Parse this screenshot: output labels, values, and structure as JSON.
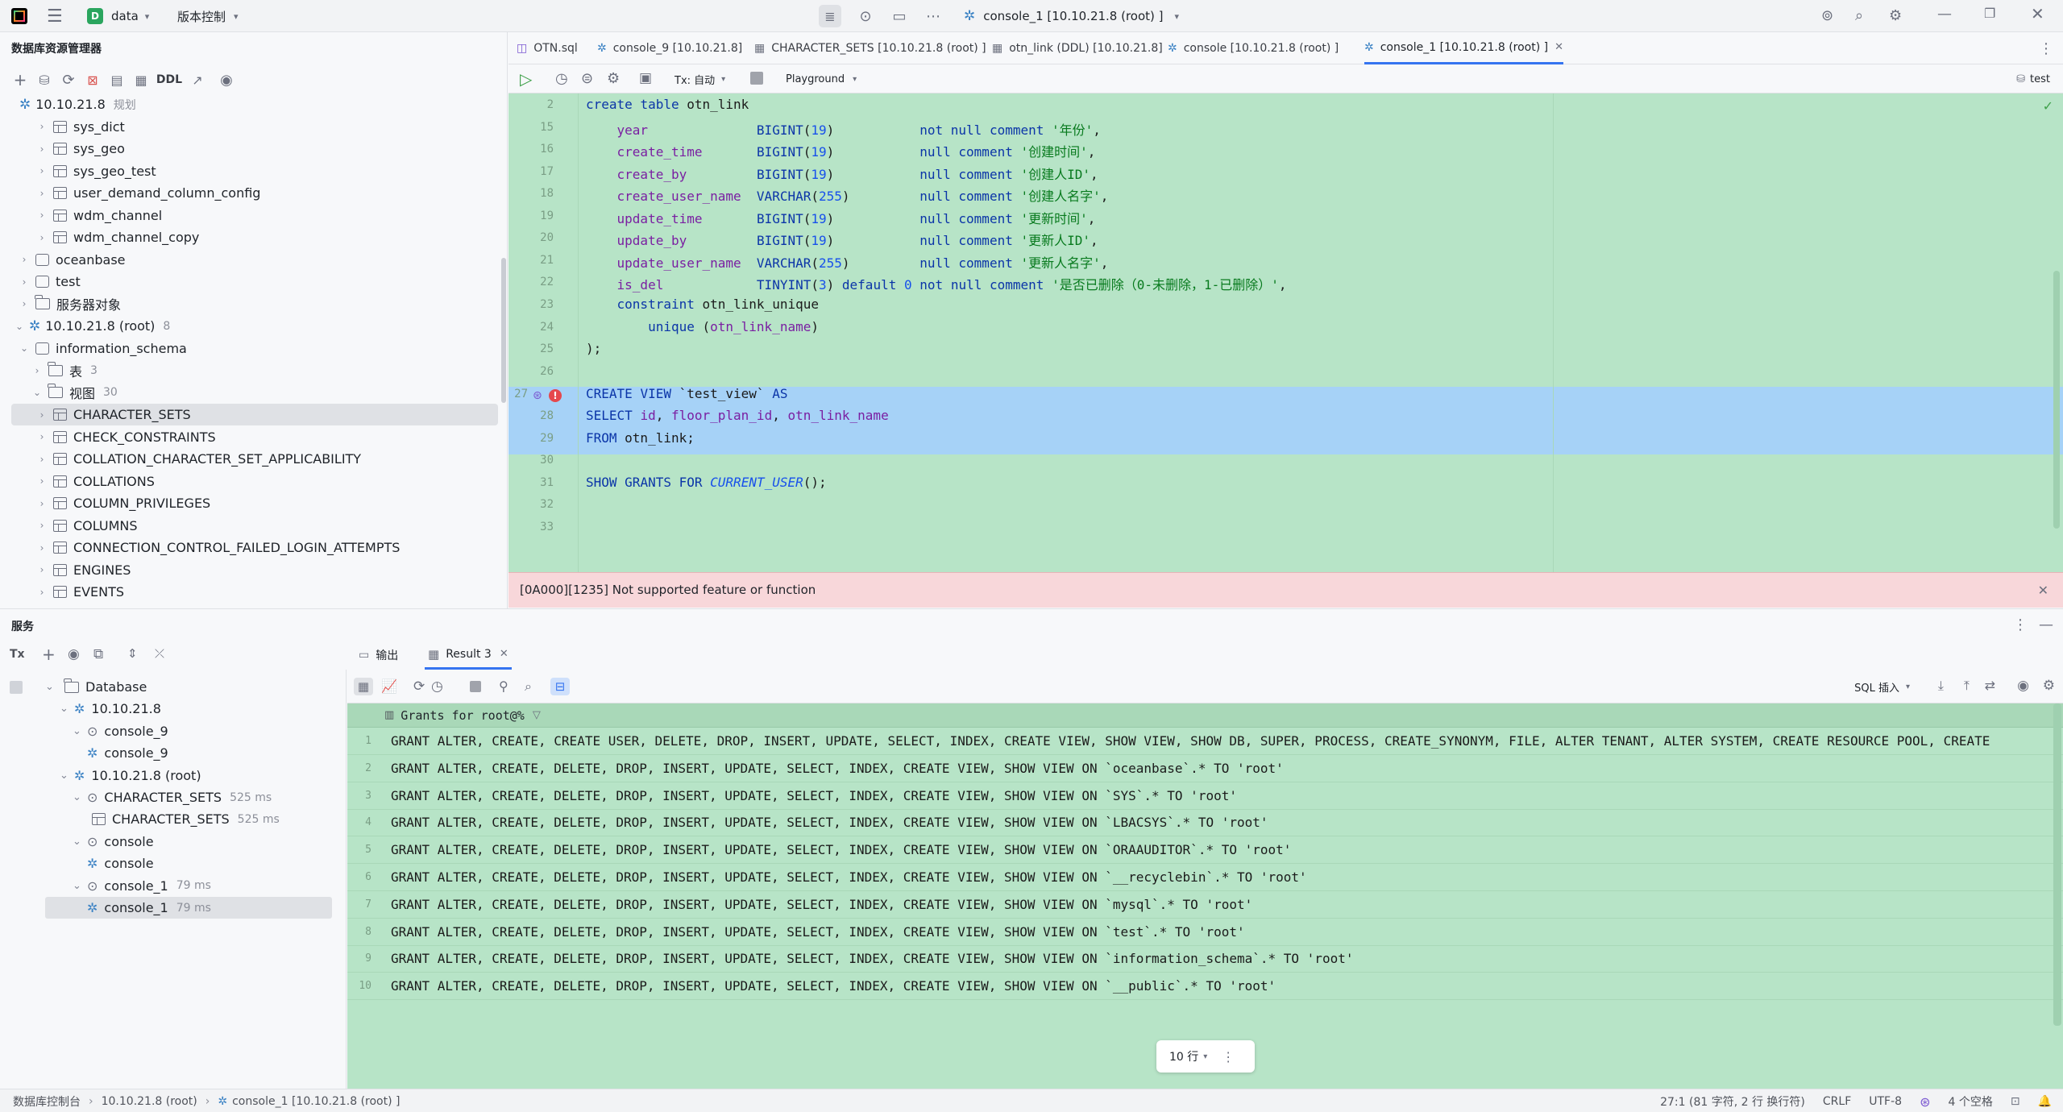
{
  "titlebar": {
    "project_badge": "D",
    "project": "data",
    "vcs": "版本控制",
    "run_config": "console_1 [10.10.21.8 (root) ]"
  },
  "explorer": {
    "title": "数据库资源管理器",
    "ddl_label": "DDL",
    "rows": [
      {
        "label": "10.10.21.8",
        "note": "规划",
        "kind": "conn"
      },
      {
        "label": "sys_dict",
        "kind": "table"
      },
      {
        "label": "sys_geo",
        "kind": "table"
      },
      {
        "label": "sys_geo_test",
        "kind": "table"
      },
      {
        "label": "user_demand_column_config",
        "kind": "table"
      },
      {
        "label": "wdm_channel",
        "kind": "table"
      },
      {
        "label": "wdm_channel_copy",
        "kind": "table"
      },
      {
        "label": "oceanbase",
        "kind": "db"
      },
      {
        "label": "test",
        "kind": "db"
      },
      {
        "label": "服务器对象",
        "kind": "folder"
      },
      {
        "label": "10.10.21.8  (root)",
        "note": "8",
        "kind": "conn"
      },
      {
        "label": "information_schema",
        "kind": "db"
      },
      {
        "label": "表",
        "note": "3",
        "kind": "folder"
      },
      {
        "label": "视图",
        "note": "30",
        "kind": "folder"
      },
      {
        "label": "CHARACTER_SETS",
        "kind": "table"
      },
      {
        "label": "CHECK_CONSTRAINTS",
        "kind": "table"
      },
      {
        "label": "COLLATION_CHARACTER_SET_APPLICABILITY",
        "kind": "table"
      },
      {
        "label": "COLLATIONS",
        "kind": "table"
      },
      {
        "label": "COLUMN_PRIVILEGES",
        "kind": "table"
      },
      {
        "label": "COLUMNS",
        "kind": "table"
      },
      {
        "label": "CONNECTION_CONTROL_FAILED_LOGIN_ATTEMPTS",
        "kind": "table"
      },
      {
        "label": "ENGINES",
        "kind": "table"
      },
      {
        "label": "EVENTS",
        "kind": "table"
      }
    ]
  },
  "tabs": [
    {
      "label": "OTN.sql"
    },
    {
      "label": "console_9 [10.10.21.8]"
    },
    {
      "label": "CHARACTER_SETS [10.10.21.8  (root) ]"
    },
    {
      "label": "otn_link (DDL) [10.10.21.8]"
    },
    {
      "label": "console [10.10.21.8  (root) ]"
    },
    {
      "label": "console_1 [10.10.21.8  (root) ]"
    }
  ],
  "toolbar": {
    "tx_label": "Tx: 自动",
    "playground": "Playground",
    "schema": "test"
  },
  "editor": {
    "lines": [
      {
        "n": "2",
        "code": "create table otn_link"
      },
      {
        "n": "15",
        "code": "    year              BIGINT(19)           not null comment '年份',"
      },
      {
        "n": "16",
        "code": "    create_time       BIGINT(19)           null comment '创建时间',"
      },
      {
        "n": "17",
        "code": "    create_by         BIGINT(19)           null comment '创建人ID',"
      },
      {
        "n": "18",
        "code": "    create_user_name  VARCHAR(255)         null comment '创建人名字',"
      },
      {
        "n": "19",
        "code": "    update_time       BIGINT(19)           null comment '更新时间',"
      },
      {
        "n": "20",
        "code": "    update_by         BIGINT(19)           null comment '更新人ID',"
      },
      {
        "n": "21",
        "code": "    update_user_name  VARCHAR(255)         null comment '更新人名字',"
      },
      {
        "n": "22",
        "code": "    is_del            TINYINT(3) default 0 not null comment '是否已删除（0-未删除，1-已删除）',"
      },
      {
        "n": "23",
        "code": "    constraint otn_link_unique"
      },
      {
        "n": "24",
        "code": "        unique (otn_link_name)"
      },
      {
        "n": "25",
        "code": ");"
      },
      {
        "n": "26",
        "code": ""
      },
      {
        "n": "27",
        "code": "CREATE VIEW `test_view` AS"
      },
      {
        "n": "28",
        "code": "SELECT id, floor_plan_id, otn_link_name"
      },
      {
        "n": "29",
        "code": "FROM otn_link;"
      },
      {
        "n": "30",
        "code": ""
      },
      {
        "n": "31",
        "code": "SHOW GRANTS FOR CURRENT_USER();"
      },
      {
        "n": "32",
        "code": ""
      },
      {
        "n": "33",
        "code": ""
      }
    ],
    "error": "[0A000][1235] Not supported feature or function"
  },
  "services": {
    "title": "服务",
    "tx": "Tx",
    "tree": [
      {
        "label": "Database",
        "time": "",
        "level": 0
      },
      {
        "label": "10.10.21.8",
        "time": "",
        "level": 1
      },
      {
        "label": "console_9",
        "time": "",
        "level": 2
      },
      {
        "label": "console_9",
        "time": "",
        "level": 3
      },
      {
        "label": "10.10.21.8  (root)",
        "time": "",
        "level": 1
      },
      {
        "label": "CHARACTER_SETS",
        "time": "525 ms",
        "level": 2
      },
      {
        "label": "CHARACTER_SETS",
        "time": "525 ms",
        "level": 3
      },
      {
        "label": "console",
        "time": "",
        "level": 2
      },
      {
        "label": "console",
        "time": "",
        "level": 3
      },
      {
        "label": "console_1",
        "time": "79 ms",
        "level": 2
      },
      {
        "label": "console_1",
        "time": "79 ms",
        "level": 3
      }
    ]
  },
  "results": {
    "tab_output": "输出",
    "tab_result": "Result 3",
    "sql_insert": "SQL 插入",
    "column": "Grants for root@%",
    "rows": [
      "GRANT ALTER, CREATE, CREATE USER, DELETE, DROP, INSERT, UPDATE, SELECT, INDEX, CREATE VIEW, SHOW VIEW, SHOW DB, SUPER, PROCESS, CREATE_SYNONYM, FILE, ALTER TENANT, ALTER SYSTEM, CREATE RESOURCE POOL, CREATE",
      "GRANT ALTER, CREATE, DELETE, DROP, INSERT, UPDATE, SELECT, INDEX, CREATE VIEW, SHOW VIEW ON `oceanbase`.* TO 'root'",
      "GRANT ALTER, CREATE, DELETE, DROP, INSERT, UPDATE, SELECT, INDEX, CREATE VIEW, SHOW VIEW ON `SYS`.* TO 'root'",
      "GRANT ALTER, CREATE, DELETE, DROP, INSERT, UPDATE, SELECT, INDEX, CREATE VIEW, SHOW VIEW ON `LBACSYS`.* TO 'root'",
      "GRANT ALTER, CREATE, DELETE, DROP, INSERT, UPDATE, SELECT, INDEX, CREATE VIEW, SHOW VIEW ON `ORAAUDITOR`.* TO 'root'",
      "GRANT ALTER, CREATE, DELETE, DROP, INSERT, UPDATE, SELECT, INDEX, CREATE VIEW, SHOW VIEW ON `__recyclebin`.* TO 'root'",
      "GRANT ALTER, CREATE, DELETE, DROP, INSERT, UPDATE, SELECT, INDEX, CREATE VIEW, SHOW VIEW ON `mysql`.* TO 'root'",
      "GRANT ALTER, CREATE, DELETE, DROP, INSERT, UPDATE, SELECT, INDEX, CREATE VIEW, SHOW VIEW ON `test`.* TO 'root'",
      "GRANT ALTER, CREATE, DELETE, DROP, INSERT, UPDATE, SELECT, INDEX, CREATE VIEW, SHOW VIEW ON `information_schema`.* TO 'root'",
      "GRANT ALTER, CREATE, DELETE, DROP, INSERT, UPDATE, SELECT, INDEX, CREATE VIEW, SHOW VIEW ON `__public`.* TO 'root'"
    ],
    "row_count": "10 行"
  },
  "statusbar": {
    "crumb1": "数据库控制台",
    "crumb2": "10.10.21.8 (root)",
    "crumb3": "console_1 [10.10.21.8  (root) ]",
    "position": "27:1 (81 字符, 2 行 换行符)",
    "line_sep": "CRLF",
    "encoding": "UTF-8",
    "indent": "4 个空格"
  },
  "colors": {
    "editor_bg": "#b7e4c7",
    "selection": "#a6d2f7",
    "error_bg": "#f8d7da",
    "accent": "#3574f0"
  }
}
